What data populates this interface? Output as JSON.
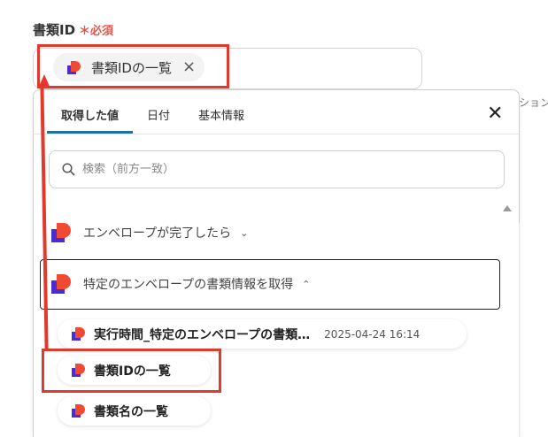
{
  "field": {
    "label": "書類ID",
    "required_mark": "＊必須",
    "selected_token": "書類IDの一覧",
    "remove_glyph": "×"
  },
  "side_text": "ション",
  "dropdown": {
    "tabs": [
      {
        "label": "取得した値",
        "active": true
      },
      {
        "label": "日付",
        "active": false
      },
      {
        "label": "基本情報",
        "active": false
      }
    ],
    "close_glyph": "✕",
    "search_placeholder": "検索（前方一致）",
    "groups": [
      {
        "label": "エンベロープが完了したら",
        "expanded": false,
        "chevron": "⌄"
      },
      {
        "label": "特定のエンベロープの書類情報を取得",
        "expanded": true,
        "chevron": "⌃"
      }
    ],
    "items": [
      {
        "label": "実行時間_特定のエンベロープの書類…",
        "timestamp": "2025-04-24 16:14"
      },
      {
        "label": "書類IDの一覧",
        "timestamp": ""
      },
      {
        "label": "書類名の一覧",
        "timestamp": ""
      }
    ]
  },
  "colors": {
    "accent_tab": "#1f6f9f",
    "highlight": "#e2392c",
    "required": "#e2574c",
    "logo_red": "#f04a33",
    "logo_purple": "#4b2bd6"
  },
  "icons": [
    "docusign-logo-icon",
    "close-icon",
    "search-icon",
    "chevron-down-icon",
    "chevron-up-icon",
    "scroll-up-icon"
  ]
}
